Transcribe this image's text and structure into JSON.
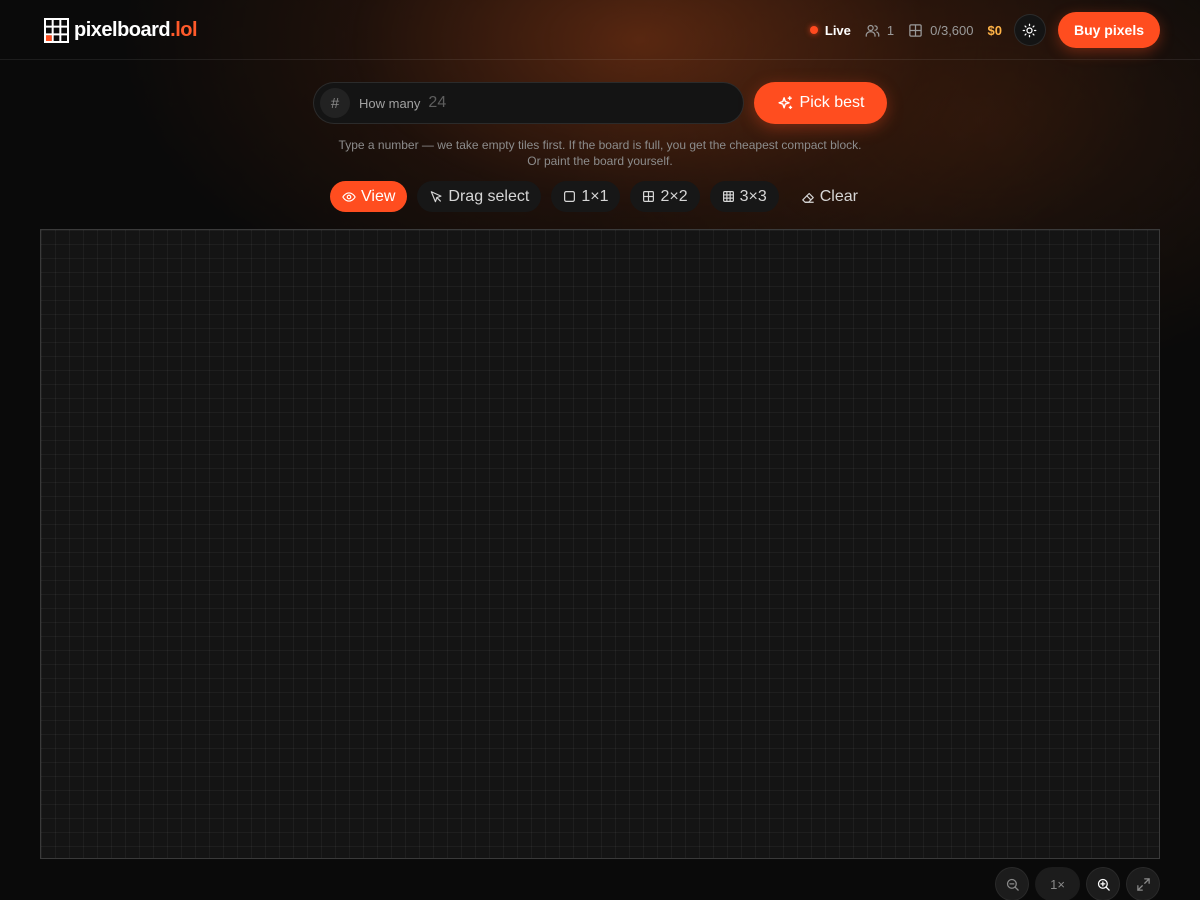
{
  "header": {
    "logo_name": "pixelboard",
    "logo_tld": ".lol",
    "live_label": "Live",
    "users_count": "1",
    "tiles_count": "0/3,600",
    "balance": "$0",
    "buy_label": "Buy pixels"
  },
  "picker": {
    "hash": "#",
    "label": "How many",
    "placeholder": "24",
    "value": "",
    "button_label": "Pick best",
    "helper_line1": "Type a number — we take empty tiles first. If the board is full, you get the cheapest compact block.",
    "helper_line2": "Or paint the board yourself."
  },
  "modes": {
    "view": "View",
    "drag": "Drag select",
    "one": "1×1",
    "two": "2×2",
    "three": "3×3",
    "clear": "Clear",
    "active": "View"
  },
  "zoom": {
    "level": "1×"
  },
  "colors": {
    "accent": "#ff4d1f",
    "balance": "#ffb347",
    "live_dot": "#ff4a1f"
  },
  "icons": {
    "logo": "grid-logo-icon",
    "users": "users-icon",
    "tiles": "grid-icon",
    "theme": "sun-icon",
    "pick": "sparkles-icon",
    "view": "eye-icon",
    "drag": "cursor-icon",
    "one": "square-icon",
    "two": "grid-2x2-icon",
    "three": "grid-3x3-icon",
    "clear": "eraser-icon",
    "zoom_out": "zoom-out-icon",
    "zoom_in": "zoom-in-icon",
    "fullscreen": "expand-icon"
  }
}
